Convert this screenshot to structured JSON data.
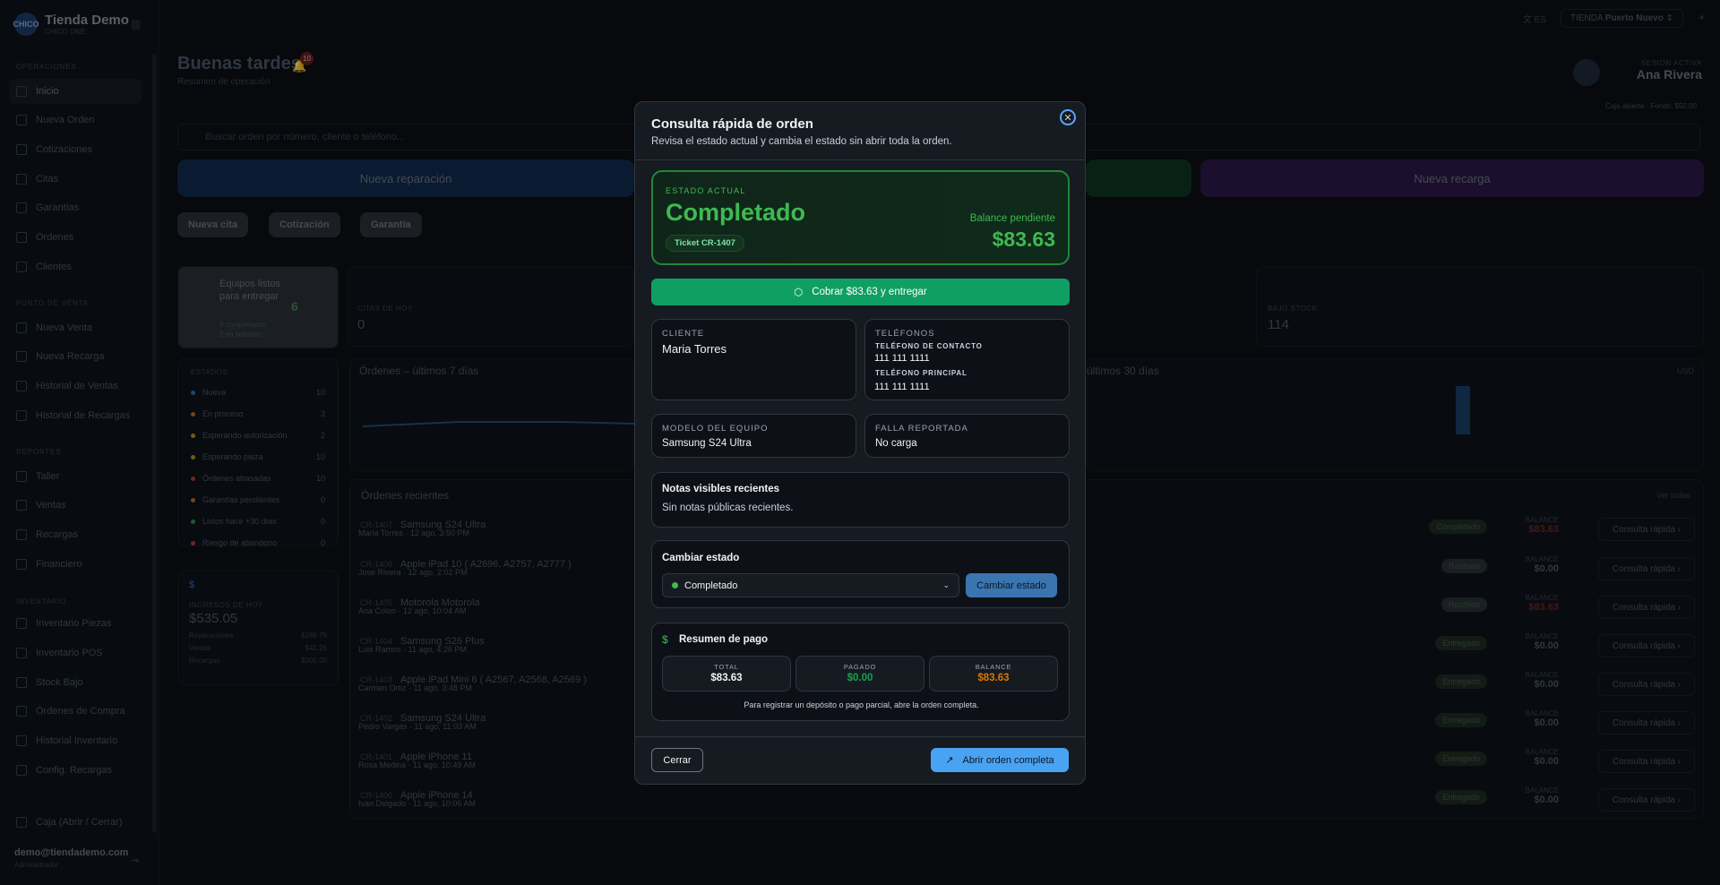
{
  "brand": {
    "name": "Tienda Demo",
    "sub": "CHICO ONE",
    "logo_text": "CHICO"
  },
  "sidebar": {
    "sections": [
      "OPERACIONES",
      "PUNTO DE VENTA",
      "REPORTES",
      "INVENTARIO"
    ],
    "items": [
      {
        "label": "Inicio"
      },
      {
        "label": "Nueva Orden"
      },
      {
        "label": "Cotizaciones"
      },
      {
        "label": "Citas"
      },
      {
        "label": "Garantías"
      },
      {
        "label": "Órdenes"
      },
      {
        "label": "Clientes"
      },
      {
        "label": "Nueva Venta"
      },
      {
        "label": "Nueva Recarga"
      },
      {
        "label": "Historial de Ventas"
      },
      {
        "label": "Historial de Recargas"
      },
      {
        "label": "Taller"
      },
      {
        "label": "Ventas"
      },
      {
        "label": "Recargas"
      },
      {
        "label": "Financiero"
      },
      {
        "label": "Inventario Piezas"
      },
      {
        "label": "Inventario POS"
      },
      {
        "label": "Stock Bajo"
      },
      {
        "label": "Órdenes de Compra"
      },
      {
        "label": "Historial Inventario"
      },
      {
        "label": "Config. Recargas"
      },
      {
        "label": "Caja (Abrir / Cerrar)"
      }
    ],
    "user_email": "demo@tiendademo.com",
    "user_role": "Administrador"
  },
  "topbar": {
    "lang": "ES",
    "store_label": "TIENDA",
    "store_name": "Puerto Nuevo"
  },
  "header": {
    "greeting": "Buenas tardes",
    "sub": "Resumen de operación",
    "notif_count": "10",
    "session_label": "SESIÓN ACTIVA",
    "session_name": "Ana Rivera",
    "caja": "Caja abierta · Fondo: $50.00"
  },
  "search_placeholder": "Buscar orden por número, cliente o teléfono...",
  "actions": {
    "nueva_reparacion": "Nueva reparación",
    "nueva_recarga": "Nueva recarga",
    "nueva_cita": "Nueva cita",
    "cotizacion": "Cotización",
    "garantia": "Garantía"
  },
  "listos": {
    "title": "Equipos listos para entregar",
    "count": "6",
    "l1": "4 completados",
    "l2": "2 en solución"
  },
  "stats": {
    "citas_label": "CITAS DE HOY",
    "citas_val": "0",
    "stock_label": "BAJO STOCK",
    "stock_val": "114"
  },
  "estados": {
    "title": "ESTADOS",
    "rows": [
      {
        "label": "Nueva",
        "value": "10",
        "color": "#2f6bb3"
      },
      {
        "label": "En proceso",
        "value": "3",
        "color": "#b36b1f"
      },
      {
        "label": "Esperando autorización",
        "value": "2",
        "color": "#b38a1f"
      },
      {
        "label": "Esperando pieza",
        "value": "10",
        "color": "#b38a1f"
      },
      {
        "label": "Órdenes atrasadas",
        "value": "10",
        "color": "#b33a2f"
      },
      {
        "label": "Garantías pendientes",
        "value": "0",
        "color": "#b36b1f"
      },
      {
        "label": "Listos hace +30 días",
        "value": "0",
        "color": "#2f8b4a"
      },
      {
        "label": "Riesgo de abandono",
        "value": "0",
        "color": "#b33a2f"
      }
    ]
  },
  "ingresos": {
    "label": "INGRESOS DE HOY",
    "value": "$535.05",
    "rows": [
      {
        "label": "Reparaciones",
        "value": "$288.79"
      },
      {
        "label": "Ventas",
        "value": "$41.26"
      },
      {
        "label": "Recargas",
        "value": "$205.00"
      }
    ]
  },
  "charts": {
    "left_title": "Órdenes – últimos 7 días",
    "right_title": "últimos 30 días",
    "right_unit": "USD"
  },
  "recent": {
    "title": "Órdenes recientes",
    "link": "Ver todas",
    "rows": [
      {
        "id": "CR-1407",
        "device": "Samsung S24 Ultra",
        "sub": "Maria Torres · 12 ago, 3:50 PM",
        "status": "Completado",
        "balance": "$83.63",
        "quick": "Consulta rápida"
      },
      {
        "id": "CR-1406",
        "device": "Apple iPad 10 ( A2696, A2757, A2777 )",
        "sub": "Jose Rivera · 12 ago, 2:02 PM",
        "status": "Recibido",
        "balance": "$0.00",
        "quick": "Consulta rápida"
      },
      {
        "id": "CR-1405",
        "device": "Motorola Motorola",
        "sub": "Ana Colon · 12 ago, 10:04 AM",
        "status": "Recibido",
        "balance": "$83.63",
        "quick": "Consulta rápida"
      },
      {
        "id": "CR-1404",
        "device": "Samsung S26 Plus",
        "sub": "Luis Ramos · 11 ago, 4:26 PM",
        "status": "Entregado",
        "balance": "$0.00",
        "quick": "Consulta rápida"
      },
      {
        "id": "CR-1403",
        "device": "Apple iPad Mini 6 ( A2567, A2568, A2569 )",
        "sub": "Carmen Ortiz · 11 ago, 3:48 PM",
        "status": "Entregado",
        "balance": "$0.00",
        "quick": "Consulta rápida"
      },
      {
        "id": "CR-1402",
        "device": "Samsung S24 Ultra",
        "sub": "Pedro Vargas · 11 ago, 11:03 AM",
        "status": "Entregado",
        "balance": "$0.00",
        "quick": "Consulta rápida"
      },
      {
        "id": "CR-1401",
        "device": "Apple iPhone 11",
        "sub": "Rosa Medina · 11 ago, 10:49 AM",
        "status": "Entregado",
        "balance": "$0.00",
        "quick": "Consulta rápida"
      },
      {
        "id": "CR-1400",
        "device": "Apple iPhone 14",
        "sub": "Ivan Delgado · 11 ago, 10:06 AM",
        "status": "Entregado",
        "balance": "$0.00",
        "quick": "Consulta rápida"
      }
    ],
    "balance_label": "BALANCE"
  },
  "modal": {
    "title": "Consulta rápida de orden",
    "subtitle": "Revisa el estado actual y cambia el estado sin abrir toda la orden.",
    "estado_label": "ESTADO ACTUAL",
    "estado": "Completado",
    "ticket": "Ticket CR-1407",
    "balance_label": "Balance pendiente",
    "balance": "$83.63",
    "cobrar": "Cobrar $83.63 y entregar",
    "cliente_label": "CLIENTE",
    "cliente": "Maria Torres",
    "telefonos_label": "TELÉFONOS",
    "tel_contacto_label": "TELÉFONO DE CONTACTO",
    "tel_contacto": "111 111 1111",
    "tel_principal_label": "TELÉFONO PRINCIPAL",
    "tel_principal": "111 111 1111",
    "modelo_label": "MODELO DEL EQUIPO",
    "modelo": "Samsung S24 Ultra",
    "falla_label": "FALLA REPORTADA",
    "falla": "No carga",
    "notas_title": "Notas visibles recientes",
    "notas": "Sin notas públicas recientes.",
    "cambiar_title": "Cambiar estado",
    "select_value": "Completado",
    "cambiar_btn": "Cambiar estado",
    "pago_title": "Resumen de pago",
    "total_label": "TOTAL",
    "total": "$83.63",
    "pagado_label": "PAGADO",
    "pagado": "$0.00",
    "saldo_label": "BALANCE",
    "saldo": "$83.63",
    "pago_note": "Para registrar un depósito o pago parcial, abre la orden completa.",
    "cerrar": "Cerrar",
    "abrir": "Abrir orden completa"
  }
}
